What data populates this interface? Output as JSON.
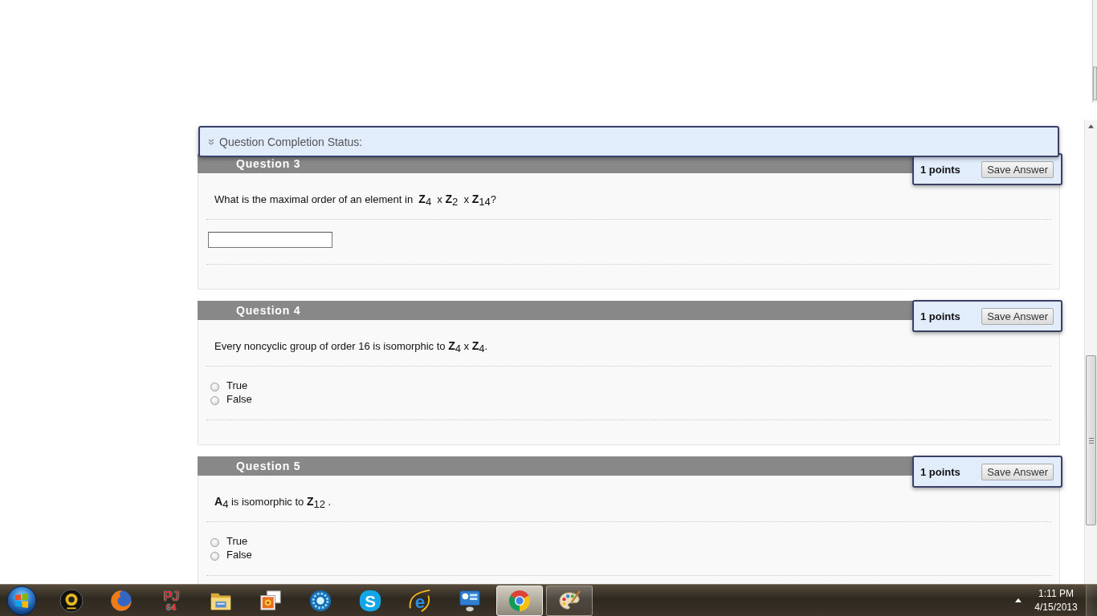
{
  "status_bar": {
    "label": "Question Completion Status:",
    "expanded": false
  },
  "questions": [
    {
      "title": "Question 3",
      "points": "1 points",
      "save_button": "Save Answer",
      "text": "What is the maximal order of an element in  **Z**$_{4}$  x **Z**$_{2}$  x **Z**$_{14}$?",
      "answer": {
        "kind": "text"
      }
    },
    {
      "title": "Question 4",
      "points": "1 points",
      "save_button": "Save Answer",
      "text": "Every noncyclic group of order 16 is isomorphic to **Z**$_{4}$ x **Z**$_{4}$.",
      "answer": {
        "kind": "radio",
        "options": [
          {
            "label": "True",
            "selected": false
          },
          {
            "label": "False",
            "selected": false
          }
        ]
      }
    },
    {
      "title": "Question 5",
      "points": "1 points",
      "save_button": "Save Answer",
      "text": "**A**$_{4}$ is isomorphic to **Z**$_{12}$ .",
      "answer": {
        "kind": "radio",
        "options": [
          {
            "label": "True",
            "selected": false
          },
          {
            "label": "False",
            "selected": false
          }
        ]
      }
    }
  ],
  "taskbar": {
    "apps": [
      {
        "kind": "webcam",
        "running": false,
        "selected": false
      },
      {
        "kind": "globe",
        "running": false,
        "selected": false
      },
      {
        "kind": "lettered",
        "lines": [
          "PJ",
          "64"
        ],
        "running": false,
        "selected": false
      },
      {
        "kind": "folder",
        "running": false,
        "selected": false
      },
      {
        "kind": "photos",
        "running": false,
        "selected": false
      },
      {
        "kind": "orb",
        "running": false,
        "selected": false
      },
      {
        "kind": "badge",
        "letter": "S",
        "running": false,
        "selected": false
      },
      {
        "kind": "ringed",
        "letter": "e",
        "running": false,
        "selected": false
      },
      {
        "kind": "panel",
        "running": false,
        "selected": false
      },
      {
        "kind": "wheel",
        "running": true,
        "selected": true
      },
      {
        "kind": "palette",
        "running": true,
        "selected": false
      }
    ],
    "clock": {
      "time": "1:11 PM",
      "date": "4/15/2013"
    }
  }
}
